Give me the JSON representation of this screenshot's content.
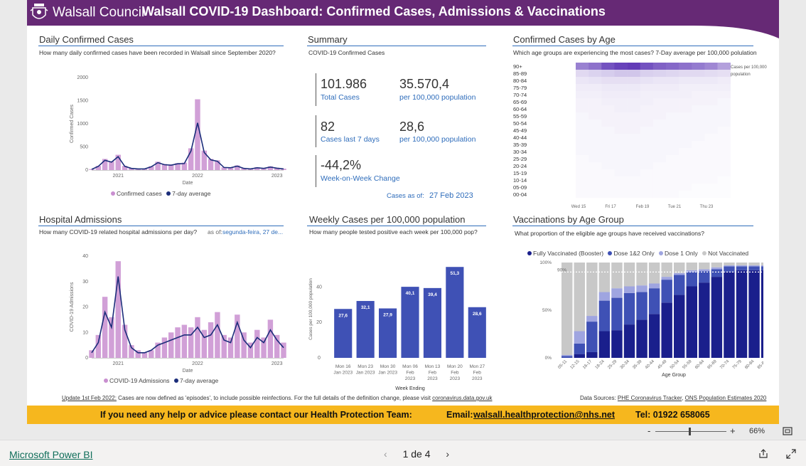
{
  "header": {
    "council_name": "Walsall Council",
    "title": "Walsall COVID-19 Dashboard:  Confirmed Cases, Admissions & Vaccinations"
  },
  "daily_cases": {
    "title": "Daily Confirmed Cases",
    "subtitle": "How many daily confirmed cases have been recorded in Walsall since September 2020?",
    "legend": [
      "Confirmed cases",
      "7-day average"
    ],
    "colors": {
      "bars": "#c98fd0",
      "avg": "#1b2d7a"
    }
  },
  "summary": {
    "title": "Summary",
    "subtitle": "COVID-19 Confirmed Cases",
    "total_cases": "101.986",
    "total_cases_label": "Total Cases",
    "total_rate": "35.570,4",
    "total_rate_label": "per 100,000 population",
    "last7": "82",
    "last7_label": "Cases last 7 days",
    "last7_rate": "28,6",
    "last7_rate_label": "per 100,000 population",
    "wow": "-44,2%",
    "wow_label": "Week-on-Week Change",
    "asof_label": "Cases as of:",
    "asof_date": "27 Feb 2023"
  },
  "age_cases": {
    "title": "Confirmed Cases by Age",
    "subtitle": "Which age groups are experiencing the most cases? 7-Day average per 100,000 polulation",
    "legend_label": "Cases per 100,000 population"
  },
  "hospital": {
    "title": "Hospital Admissions",
    "subtitle": "How many COVID-19 related hospital admissions per day?",
    "asof_label": "as of:",
    "asof_value": "segunda-feira, 27 de...",
    "legend": [
      "COVID-19 Admissions",
      "7-day average"
    ],
    "colors": {
      "bars": "#c98fd0",
      "avg": "#1b2d7a"
    }
  },
  "weekly": {
    "title": "Weekly Cases per 100,000 population",
    "subtitle": "How many people tested positive each week per 100,000 pop?",
    "color": "#3f51b5"
  },
  "vaccinations": {
    "title": "Vaccinations by Age Group",
    "subtitle": "What proportion of the eligible age groups have received vaccinations?",
    "legend": [
      "Fully Vaccinated (Booster)",
      "Dose 1&2 Only",
      "Dose 1 Only",
      "Not Vaccinated"
    ],
    "colors": [
      "#1a1f8c",
      "#3f51b5",
      "#9fa5e0",
      "#c8c8c8"
    ],
    "ref_line_label": "90%"
  },
  "footer": {
    "update_link": "Update 1st Feb 2022:",
    "update_text": " Cases are now defined as 'episodes', to include possible reinfections. For the full details of the definition change, please visit ",
    "update_url": "coronavirus.data.gov.uk",
    "sources_label": "Data Sources: ",
    "source1": "PHE Coronavirus Tracker",
    "source_sep": ", ",
    "source2": "ONS Population Estimates 2020"
  },
  "help_bar": {
    "message": "If you need any help or advice please contact our Health Protection Team:",
    "email_label": "Email:",
    "email": "walsall.healthprotection@nhs.net",
    "tel": "Tel: 01922 658065"
  },
  "zoom": {
    "minus": "-",
    "plus": "+",
    "level": "66%",
    "fraction": 0.66
  },
  "bottom_bar": {
    "brand": "Microsoft Power BI",
    "page": "1 de 4",
    "prev": "‹",
    "next": "›",
    "share_icon": "share-icon",
    "expand_icon": "expand-icon"
  },
  "chart_data": [
    {
      "type": "area",
      "name": "daily_cases",
      "xlabel": "Date",
      "ylabel": "Confirmed Cases",
      "ylim": [
        0,
        2000
      ],
      "yticks": [
        0,
        500,
        1000,
        1500,
        2000
      ],
      "xticks": [
        "2021",
        "2022",
        "2023"
      ],
      "series": [
        {
          "name": "Confirmed cases",
          "x": [
            "2020-09",
            "2020-10",
            "2020-11",
            "2020-12",
            "2021-01",
            "2021-02",
            "2021-03",
            "2021-04",
            "2021-05",
            "2021-06",
            "2021-07",
            "2021-08",
            "2021-09",
            "2021-10",
            "2021-11",
            "2021-12",
            "2022-01",
            "2022-02",
            "2022-03",
            "2022-04",
            "2022-05",
            "2022-06",
            "2022-07",
            "2022-08",
            "2022-09",
            "2022-10",
            "2022-11",
            "2022-12",
            "2023-01",
            "2023-02"
          ],
          "values": [
            20,
            90,
            240,
            190,
            330,
            90,
            40,
            30,
            30,
            80,
            180,
            130,
            120,
            150,
            160,
            470,
            1530,
            420,
            240,
            210,
            60,
            60,
            100,
            40,
            30,
            60,
            40,
            80,
            50,
            30
          ]
        },
        {
          "name": "7-day average",
          "x": [
            "2020-09",
            "2020-10",
            "2020-11",
            "2020-12",
            "2021-01",
            "2021-02",
            "2021-03",
            "2021-04",
            "2021-05",
            "2021-06",
            "2021-07",
            "2021-08",
            "2021-09",
            "2021-10",
            "2021-11",
            "2021-12",
            "2022-01",
            "2022-02",
            "2022-03",
            "2022-04",
            "2022-05",
            "2022-06",
            "2022-07",
            "2022-08",
            "2022-09",
            "2022-10",
            "2022-11",
            "2022-12",
            "2023-01",
            "2023-02"
          ],
          "values": [
            15,
            80,
            210,
            170,
            290,
            80,
            35,
            25,
            25,
            70,
            160,
            115,
            105,
            135,
            140,
            410,
            1020,
            380,
            220,
            190,
            55,
            50,
            85,
            35,
            25,
            50,
            35,
            65,
            40,
            25
          ]
        }
      ]
    },
    {
      "type": "heatmap",
      "name": "age_cases",
      "rows": [
        "90+",
        "85-89",
        "80-84",
        "75-79",
        "70-74",
        "65-69",
        "60-64",
        "55-59",
        "50-54",
        "45-49",
        "40-44",
        "35-39",
        "30-34",
        "25-29",
        "20-24",
        "15-19",
        "10-14",
        "05-09",
        "00-04"
      ],
      "x_ticks": [
        "Wed 15",
        "Fri 17",
        "Feb 19",
        "Tue 21",
        "Thu 23",
        "Sat 25"
      ],
      "columns": 14,
      "values": [
        [
          40,
          45,
          55,
          60,
          62,
          55,
          50,
          48,
          45,
          42,
          38,
          30,
          22,
          18
        ],
        [
          12,
          14,
          16,
          18,
          18,
          15,
          14,
          13,
          12,
          12,
          11,
          10,
          9,
          8
        ],
        [
          8,
          9,
          10,
          10,
          10,
          9,
          8,
          8,
          7,
          7,
          7,
          6,
          6,
          5
        ],
        [
          6,
          6,
          7,
          7,
          7,
          6,
          6,
          6,
          5,
          5,
          5,
          5,
          4,
          4
        ],
        [
          5,
          5,
          6,
          6,
          6,
          5,
          5,
          5,
          5,
          4,
          4,
          4,
          4,
          3
        ],
        [
          4,
          4,
          5,
          5,
          5,
          5,
          4,
          4,
          4,
          4,
          4,
          3,
          3,
          3
        ],
        [
          4,
          4,
          4,
          5,
          5,
          4,
          4,
          4,
          4,
          3,
          3,
          3,
          3,
          3
        ],
        [
          3,
          4,
          4,
          4,
          4,
          4,
          4,
          3,
          3,
          3,
          3,
          3,
          3,
          2
        ],
        [
          3,
          3,
          4,
          4,
          4,
          4,
          3,
          3,
          3,
          3,
          3,
          3,
          2,
          2
        ],
        [
          3,
          3,
          3,
          4,
          4,
          3,
          3,
          3,
          3,
          3,
          3,
          2,
          2,
          2
        ],
        [
          3,
          3,
          3,
          3,
          3,
          3,
          3,
          3,
          3,
          3,
          2,
          2,
          2,
          2
        ],
        [
          3,
          3,
          3,
          3,
          3,
          3,
          3,
          3,
          3,
          2,
          2,
          2,
          2,
          2
        ],
        [
          3,
          3,
          3,
          3,
          3,
          3,
          3,
          3,
          2,
          2,
          2,
          2,
          2,
          2
        ],
        [
          2,
          3,
          3,
          3,
          3,
          3,
          3,
          2,
          2,
          2,
          2,
          2,
          2,
          2
        ],
        [
          2,
          2,
          3,
          3,
          3,
          3,
          2,
          2,
          2,
          2,
          2,
          2,
          2,
          2
        ],
        [
          2,
          2,
          2,
          3,
          3,
          2,
          2,
          2,
          2,
          2,
          2,
          2,
          2,
          1
        ],
        [
          2,
          2,
          2,
          2,
          2,
          2,
          2,
          2,
          2,
          2,
          2,
          1,
          1,
          1
        ],
        [
          2,
          2,
          2,
          2,
          2,
          2,
          2,
          2,
          2,
          1,
          1,
          1,
          1,
          1
        ],
        [
          2,
          2,
          2,
          2,
          2,
          2,
          2,
          2,
          1,
          1,
          1,
          1,
          1,
          1
        ]
      ]
    },
    {
      "type": "area",
      "name": "hospital_admissions",
      "xlabel": "Date",
      "ylabel": "COVID-19 Admissions",
      "ylim": [
        0,
        40
      ],
      "yticks": [
        0,
        10,
        20,
        30,
        40
      ],
      "xticks": [
        "2021",
        "2022",
        "2023"
      ],
      "series": [
        {
          "name": "COVID-19 Admissions",
          "x": [
            "2020-09",
            "2020-10",
            "2020-11",
            "2020-12",
            "2021-01",
            "2021-02",
            "2021-03",
            "2021-04",
            "2021-05",
            "2021-06",
            "2021-07",
            "2021-08",
            "2021-09",
            "2021-10",
            "2021-11",
            "2021-12",
            "2022-01",
            "2022-02",
            "2022-03",
            "2022-04",
            "2022-05",
            "2022-06",
            "2022-07",
            "2022-08",
            "2022-09",
            "2022-10",
            "2022-11",
            "2022-12",
            "2023-01",
            "2023-02"
          ],
          "values": [
            3,
            9,
            24,
            16,
            38,
            13,
            5,
            3,
            2,
            3,
            6,
            8,
            10,
            12,
            13,
            12,
            16,
            11,
            14,
            18,
            9,
            8,
            17,
            10,
            6,
            11,
            8,
            15,
            9,
            6
          ]
        },
        {
          "name": "7-day average",
          "x": [
            "2020-09",
            "2020-10",
            "2020-11",
            "2020-12",
            "2021-01",
            "2021-02",
            "2021-03",
            "2021-04",
            "2021-05",
            "2021-06",
            "2021-07",
            "2021-08",
            "2021-09",
            "2021-10",
            "2021-11",
            "2021-12",
            "2022-01",
            "2022-02",
            "2022-03",
            "2022-04",
            "2022-05",
            "2022-06",
            "2022-07",
            "2022-08",
            "2022-09",
            "2022-10",
            "2022-11",
            "2022-12",
            "2023-01",
            "2023-02"
          ],
          "values": [
            2,
            6,
            18,
            12,
            32,
            11,
            4,
            2,
            2,
            3,
            5,
            6,
            7,
            8,
            9,
            9,
            12,
            8,
            9,
            13,
            7,
            6,
            14,
            7,
            4,
            8,
            6,
            11,
            7,
            4
          ]
        }
      ]
    },
    {
      "type": "bar",
      "name": "weekly_cases",
      "xlabel": "Week Ending",
      "ylabel": "Cases per 100,000 population",
      "ylim": [
        0,
        55
      ],
      "yticks": [
        0,
        20,
        40
      ],
      "categories": [
        [
          "Mon 16",
          "Jan 2023"
        ],
        [
          "Mon 23",
          "Jan 2023"
        ],
        [
          "Mon 30",
          "Jan 2023"
        ],
        [
          "Mon 06",
          "Feb",
          "2023"
        ],
        [
          "Mon 13",
          "Feb",
          "2023"
        ],
        [
          "Mon 20",
          "Feb",
          "2023"
        ],
        [
          "Mon 27",
          "Feb",
          "2023"
        ]
      ],
      "values": [
        27.6,
        32.1,
        27.9,
        40.1,
        39.4,
        51.3,
        28.6
      ],
      "labels": [
        "27,6",
        "32,1",
        "27,9",
        "40,1",
        "39,4",
        "51,3",
        "28,6"
      ]
    },
    {
      "type": "bar",
      "name": "vaccinations",
      "stacked": true,
      "xlabel": "Age Group",
      "ylim": [
        0,
        100
      ],
      "yticks": [
        "0%",
        "50%",
        "100%"
      ],
      "reference_line": 90,
      "categories": [
        "05-11",
        "12-15",
        "16-17",
        "18-24",
        "25-29",
        "30-34",
        "35-39",
        "40-44",
        "45-49",
        "50-54",
        "55-59",
        "60-64",
        "65-69",
        "70-74",
        "75-79",
        "80-84",
        "85-89",
        "90+"
      ],
      "series": [
        {
          "name": "Fully Vaccinated (Booster)",
          "values": [
            0,
            4,
            6,
            28,
            29,
            35,
            40,
            46,
            58,
            66,
            75,
            79,
            85,
            90,
            92,
            92,
            92,
            90
          ]
        },
        {
          "name": "Dose 1&2 Only",
          "values": [
            2,
            11,
            32,
            32,
            34,
            33,
            29,
            27,
            24,
            21,
            15,
            12,
            8,
            6,
            4,
            4,
            4,
            4
          ]
        },
        {
          "name": "Dose 1 Only",
          "values": [
            1,
            13,
            6,
            9,
            10,
            7,
            7,
            5,
            3,
            2,
            2,
            2,
            2,
            1,
            1,
            1,
            1,
            2
          ]
        },
        {
          "name": "Not Vaccinated",
          "values": [
            97,
            72,
            56,
            31,
            27,
            25,
            24,
            22,
            15,
            11,
            8,
            7,
            5,
            3,
            3,
            3,
            3,
            4
          ]
        }
      ]
    }
  ]
}
